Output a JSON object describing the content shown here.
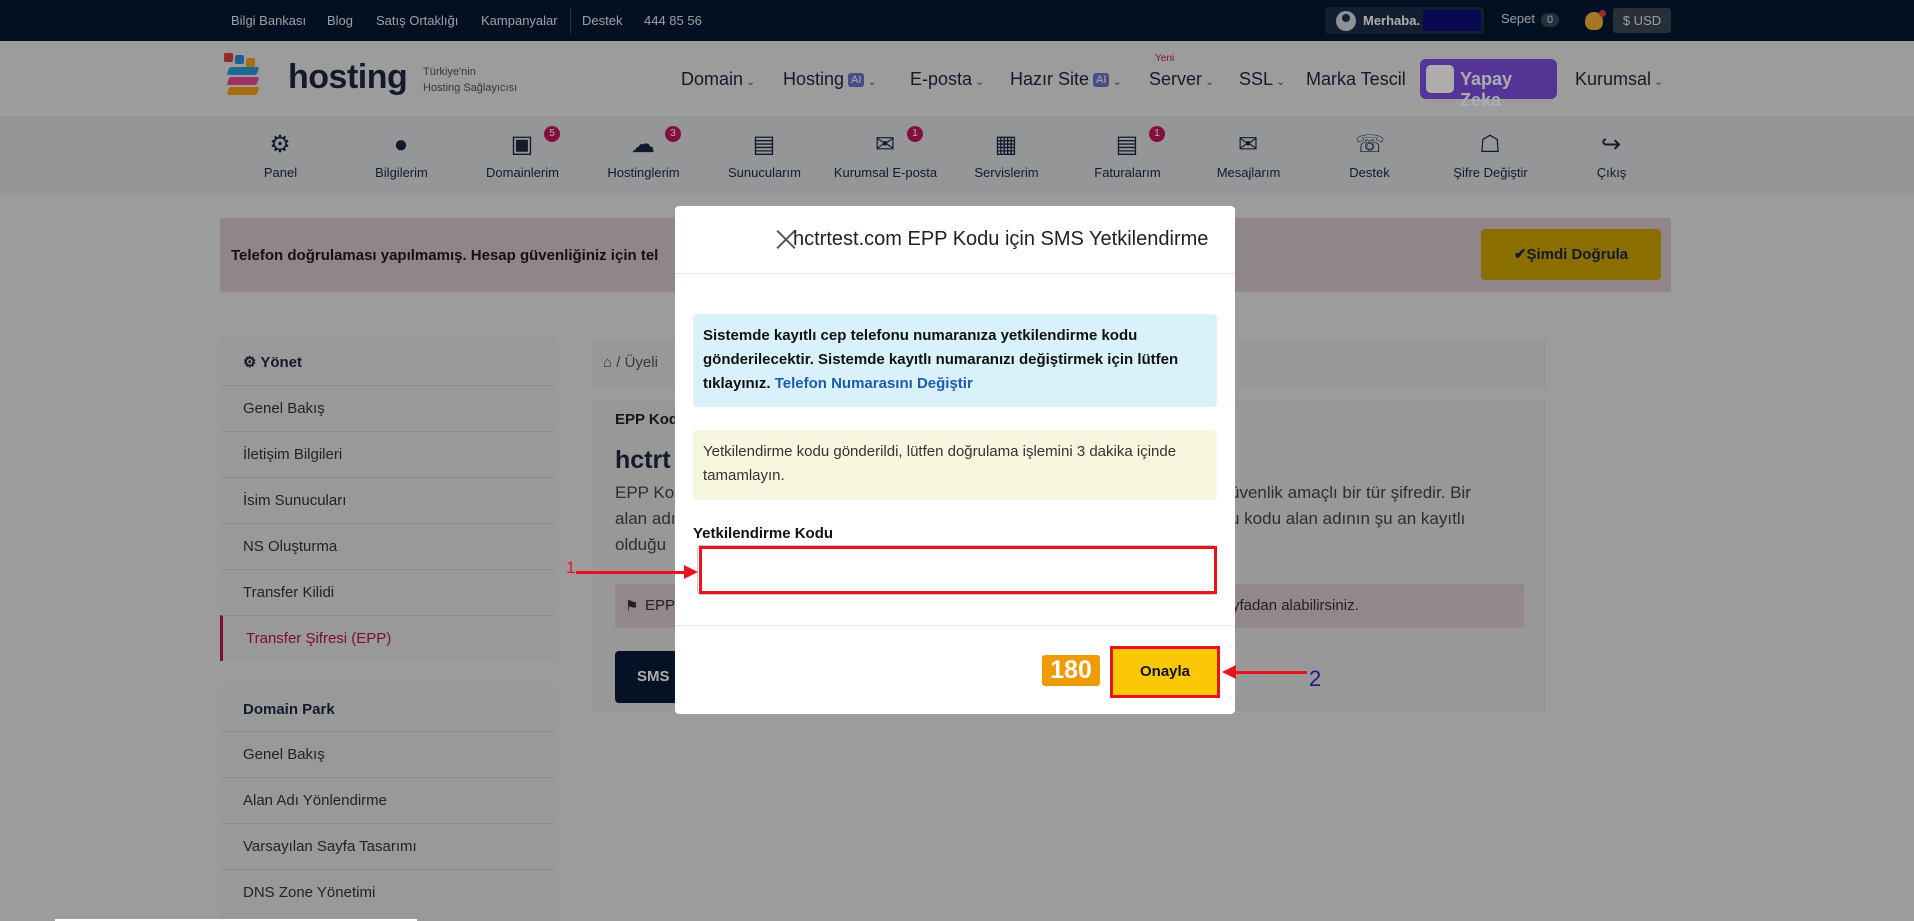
{
  "topbar": {
    "links": [
      "Bilgi Bankası",
      "Blog",
      "Satış Ortaklığı",
      "Kampanyalar"
    ],
    "support": "Destek",
    "phone": "444 85 56",
    "greeting": "Merhaba.",
    "cart_label": "Sepet",
    "cart_count": "0",
    "currency": "$ USD"
  },
  "logo": {
    "text": "hosting",
    "sub1": "Türkiye'nin",
    "sub2": "Hosting Sağlayıcısı"
  },
  "nav": {
    "items": [
      "Domain",
      "Hosting",
      "E-posta",
      "Hazır Site",
      "Server",
      "SSL",
      "Marka Tescil",
      "Kurumsal"
    ],
    "ai_badge": "AI",
    "new_label": "Yeni",
    "ai_button": "Yapay Zeka"
  },
  "iconbar": {
    "items": [
      {
        "label": "Panel",
        "icon": "gear-icon"
      },
      {
        "label": "Bilgilerim",
        "icon": "user-icon"
      },
      {
        "label": "Domainlerim",
        "icon": "browser-icon",
        "badge": "5"
      },
      {
        "label": "Hostinglerim",
        "icon": "cloud-icon",
        "badge": "3"
      },
      {
        "label": "Sunucularım",
        "icon": "server-icon"
      },
      {
        "label": "Kurumsal E-posta",
        "icon": "mail-open-icon",
        "badge": "1"
      },
      {
        "label": "Servislerim",
        "icon": "grid-icon"
      },
      {
        "label": "Faturalarım",
        "icon": "invoice-icon",
        "badge": "1"
      },
      {
        "label": "Mesajlarım",
        "icon": "envelope-icon"
      },
      {
        "label": "Destek",
        "icon": "headset-icon"
      },
      {
        "label": "Şifre Değiştir",
        "icon": "lock-icon"
      },
      {
        "label": "Çıkış",
        "icon": "logout-icon"
      }
    ]
  },
  "alert": {
    "text": "Telefon doğrulaması yapılmamış. Hesap güvenliğiniz için tel",
    "button": "Şimdi Doğrula"
  },
  "sidebar": {
    "title": "Yönet",
    "items": [
      "Genel Bakış",
      "İletişim Bilgileri",
      "İsim Sunucuları",
      "NS Oluşturma",
      "Transfer Kilidi",
      "Transfer Şifresi (EPP)"
    ],
    "section2_title": "Domain Park",
    "items2": [
      "Genel Bakış",
      "Alan Adı Yönlendirme",
      "Varsayılan Sayfa Tasarımı",
      "DNS Zone Yönetimi"
    ]
  },
  "main": {
    "breadcrumb": "Üyeli",
    "card_label": "EPP Kod",
    "heading": "hctrt",
    "para_left": [
      "EPP Kod",
      "alan adı",
      "olduğu"
    ],
    "para_right": [
      "üvenlik amaçlı bir tür şifredir. Bir",
      "u kodu alan adının şu an kayıtlı"
    ],
    "pink_left": "EPP",
    "pink_right": "yfadan alabilirsiniz.",
    "sms_button": "SMS"
  },
  "modal": {
    "title": "hctrtest.com EPP Kodu için SMS Yetkilendirme",
    "info_text": "Sistemde kayıtlı cep telefonu numaranıza yetkilendirme kodu gönderilecektir. Sistemde kayıtlı numaranızı değiştirmek için lütfen tıklayınız.",
    "info_link": "Telefon Numarasını Değiştir",
    "sent_text": "Yetkilendirme kodu gönderildi, lütfen doğrulama işlemini 3 dakika içinde tamamlayın.",
    "field_label": "Yetkilendirme Kodu",
    "field_value": "",
    "timer": "180",
    "confirm_button": "Onayla"
  },
  "annotations": {
    "one": "1",
    "two": "2"
  },
  "colors": {
    "accent": "#c3165c",
    "brand_dark": "#051933",
    "highlight": "#e8131b",
    "confirm": "#fbc808",
    "timer": "#f09a05"
  }
}
